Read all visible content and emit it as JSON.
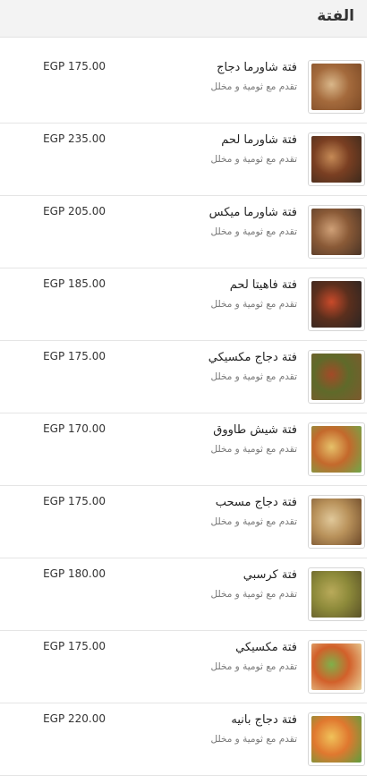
{
  "section": {
    "title": "الفتة"
  },
  "items": [
    {
      "name": "فتة شاورما دجاج",
      "description": "تقدم مع ثومية و مخلل",
      "price": "EGP 175.00",
      "photo_colors": [
        "#a46a3c",
        "#d9b78a",
        "#7c4a26"
      ]
    },
    {
      "name": "فتة شاورما لحم",
      "description": "تقدم مع ثومية و مخلل",
      "price": "EGP 235.00",
      "photo_colors": [
        "#7a3f22",
        "#c58a56",
        "#3d2a1c"
      ]
    },
    {
      "name": "فتة شاورما ميكس",
      "description": "تقدم مع ثومية و مخلل",
      "price": "EGP 205.00",
      "photo_colors": [
        "#8a5a37",
        "#cfa077",
        "#4a3426"
      ]
    },
    {
      "name": "فتة فاهيتا لحم",
      "description": "تقدم مع ثومية و مخلل",
      "price": "EGP 185.00",
      "photo_colors": [
        "#5b2f1d",
        "#c94a2a",
        "#2b2523"
      ]
    },
    {
      "name": "فتة دجاج مكسيكي",
      "description": "تقدم مع ثومية و مخلل",
      "price": "EGP 175.00",
      "photo_colors": [
        "#5f6a2a",
        "#a34a27",
        "#7d5a2e"
      ]
    },
    {
      "name": "فتة شيش طاووق",
      "description": "تقدم مع ثومية و مخلل",
      "price": "EGP 170.00",
      "photo_colors": [
        "#c4692c",
        "#e6c16a",
        "#6fa84a"
      ]
    },
    {
      "name": "فتة دجاج مسحب",
      "description": "تقدم مع ثومية و مخلل",
      "price": "EGP 175.00",
      "photo_colors": [
        "#b8915a",
        "#e0c89a",
        "#6e4a2a"
      ]
    },
    {
      "name": "فتة كرسبي",
      "description": "تقدم مع ثومية و مخلل",
      "price": "EGP 180.00",
      "photo_colors": [
        "#8d8a3a",
        "#b9aa5a",
        "#5a5228"
      ]
    },
    {
      "name": "فتة مكسيكي",
      "description": "تقدم مع ثومية و مخلل",
      "price": "EGP 175.00",
      "photo_colors": [
        "#d2602a",
        "#7fb04a",
        "#e8d29a"
      ]
    },
    {
      "name": "فتة دجاج بانيه",
      "description": "تقدم مع ثومية و مخلل",
      "price": "EGP 220.00",
      "photo_colors": [
        "#e0782f",
        "#f0c25a",
        "#5e9e3e"
      ]
    }
  ]
}
